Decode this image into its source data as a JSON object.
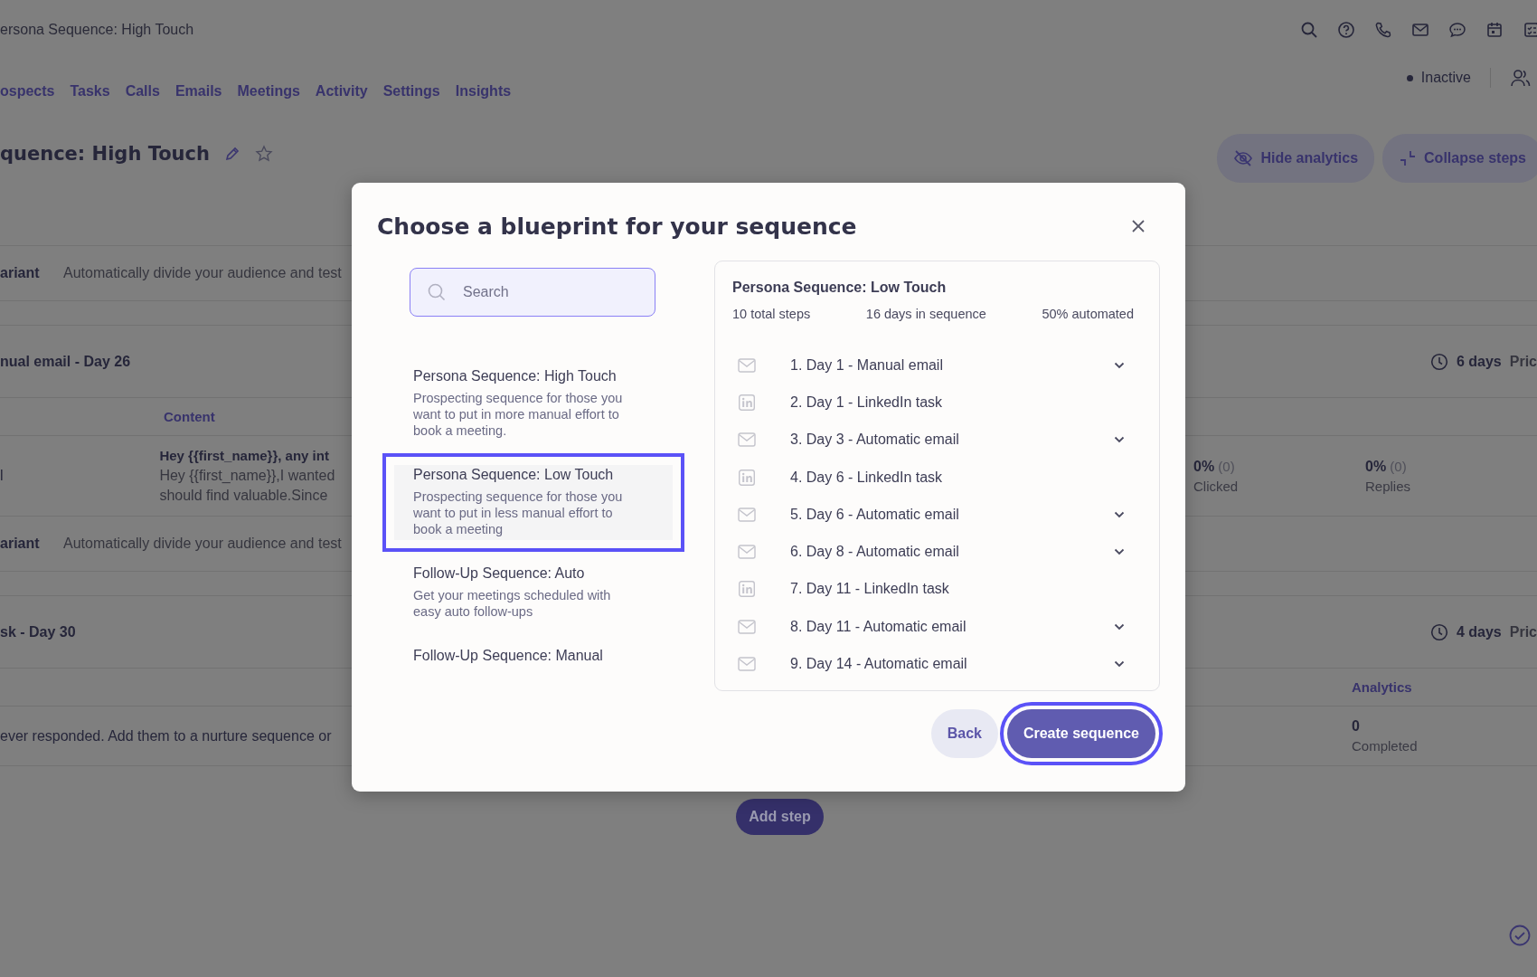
{
  "top_bar": {
    "title": "ersona Sequence: High Touch",
    "status": "Inactive"
  },
  "nav": {
    "items": [
      "ospects",
      "Tasks",
      "Calls",
      "Emails",
      "Meetings",
      "Activity",
      "Settings",
      "Insights"
    ]
  },
  "header": {
    "title": "quence: High Touch",
    "starred": false,
    "buttons": [
      "Hide analytics",
      "Collapse steps"
    ]
  },
  "background_rows": [
    {
      "kind": "cut"
    },
    {
      "kind": "variant",
      "label": "ariant",
      "text": "Automatically divide your audience and test"
    },
    {
      "kind": "gap"
    },
    {
      "kind": "step",
      "title": "nual email - Day 26",
      "delay": "6 days",
      "column_3": "Pric"
    },
    {
      "kind": "header",
      "content": "Content"
    },
    {
      "kind": "email",
      "column_1": "l",
      "subject": "Hey {{first_name}}, any int",
      "body": [
        "Hey {{first_name}},I wanted",
        "should find valuable.Since"
      ],
      "stats": [
        {
          "value": "0%",
          "count": "(0)",
          "label": "Clicked"
        },
        {
          "value": "0%",
          "count": "(0)",
          "label": "Replies"
        }
      ]
    },
    {
      "kind": "variant",
      "label": "ariant",
      "text": "Automatically divide your audience and test"
    },
    {
      "kind": "gap"
    },
    {
      "kind": "step",
      "title": "sk - Day 30",
      "delay": "4 days",
      "column_3": "Pric"
    },
    {
      "kind": "header",
      "analytics": "Analytics"
    },
    {
      "kind": "summary",
      "text": "ever responded. Add them to a nurture sequence or",
      "stat": {
        "value": "0",
        "label": "Completed"
      }
    }
  ],
  "add_step": "Add step",
  "modal": {
    "title": "Choose a blueprint for your sequence",
    "search": {
      "placeholder": "Search"
    },
    "blueprints": [
      {
        "title": "Persona Sequence: High Touch",
        "description": "Prospecting sequence for those you want to put in more manual effort to book a meeting.",
        "selected": false
      },
      {
        "title": "Persona Sequence: Low Touch",
        "description": "Prospecting sequence for those you want to put in less manual effort to book a meeting",
        "selected": true
      },
      {
        "title": "Follow-Up Sequence: Auto",
        "description": "Get your meetings scheduled with easy auto follow-ups",
        "selected": false
      },
      {
        "title": "Follow-Up Sequence: Manual",
        "selected": false
      }
    ],
    "preview": {
      "title": "Persona Sequence: Low Touch",
      "stats": [
        "10 total steps",
        "16 days in sequence",
        "50% automated"
      ],
      "steps": [
        {
          "kind": "email",
          "label": "1. Day 1 - Manual email",
          "expandable": true
        },
        {
          "kind": "linkedin",
          "label": "2. Day 1 - LinkedIn task",
          "expandable": false
        },
        {
          "kind": "email",
          "label": "3. Day 3 - Automatic email",
          "expandable": true
        },
        {
          "kind": "linkedin",
          "label": "4. Day 6 - LinkedIn task",
          "expandable": false
        },
        {
          "kind": "email",
          "label": "5. Day 6 - Automatic email",
          "expandable": true
        },
        {
          "kind": "email",
          "label": "6. Day 8 - Automatic email",
          "expandable": true
        },
        {
          "kind": "linkedin",
          "label": "7. Day 11 - LinkedIn task",
          "expandable": false
        },
        {
          "kind": "email",
          "label": "8. Day 11 - Automatic email",
          "expandable": true
        },
        {
          "kind": "email",
          "label": "9. Day 14 - Automatic email",
          "expandable": true
        }
      ]
    },
    "buttons": [
      {
        "label": "Back",
        "kind": "secondary",
        "highlighted": false
      },
      {
        "label": "Create sequence",
        "kind": "primary",
        "highlighted": true
      }
    ]
  }
}
